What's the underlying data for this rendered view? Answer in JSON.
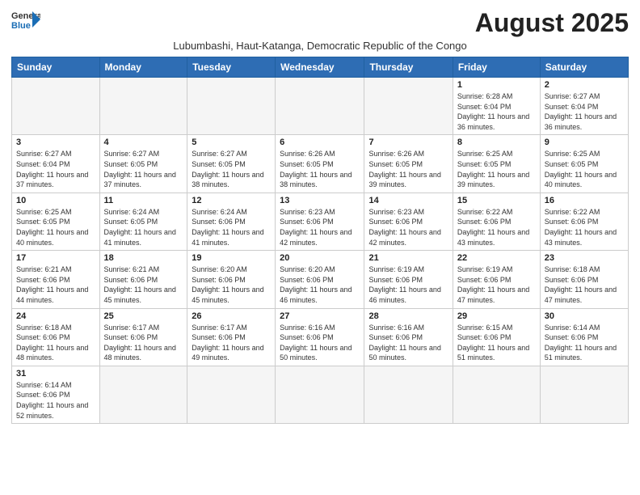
{
  "logo": {
    "line1": "General",
    "line2": "Blue"
  },
  "title": "August 2025",
  "subtitle": "Lubumbashi, Haut-Katanga, Democratic Republic of the Congo",
  "days_of_week": [
    "Sunday",
    "Monday",
    "Tuesday",
    "Wednesday",
    "Thursday",
    "Friday",
    "Saturday"
  ],
  "weeks": [
    [
      {
        "day": "",
        "info": ""
      },
      {
        "day": "",
        "info": ""
      },
      {
        "day": "",
        "info": ""
      },
      {
        "day": "",
        "info": ""
      },
      {
        "day": "",
        "info": ""
      },
      {
        "day": "1",
        "info": "Sunrise: 6:28 AM\nSunset: 6:04 PM\nDaylight: 11 hours and 36 minutes."
      },
      {
        "day": "2",
        "info": "Sunrise: 6:27 AM\nSunset: 6:04 PM\nDaylight: 11 hours and 36 minutes."
      }
    ],
    [
      {
        "day": "3",
        "info": "Sunrise: 6:27 AM\nSunset: 6:04 PM\nDaylight: 11 hours and 37 minutes."
      },
      {
        "day": "4",
        "info": "Sunrise: 6:27 AM\nSunset: 6:05 PM\nDaylight: 11 hours and 37 minutes."
      },
      {
        "day": "5",
        "info": "Sunrise: 6:27 AM\nSunset: 6:05 PM\nDaylight: 11 hours and 38 minutes."
      },
      {
        "day": "6",
        "info": "Sunrise: 6:26 AM\nSunset: 6:05 PM\nDaylight: 11 hours and 38 minutes."
      },
      {
        "day": "7",
        "info": "Sunrise: 6:26 AM\nSunset: 6:05 PM\nDaylight: 11 hours and 39 minutes."
      },
      {
        "day": "8",
        "info": "Sunrise: 6:25 AM\nSunset: 6:05 PM\nDaylight: 11 hours and 39 minutes."
      },
      {
        "day": "9",
        "info": "Sunrise: 6:25 AM\nSunset: 6:05 PM\nDaylight: 11 hours and 40 minutes."
      }
    ],
    [
      {
        "day": "10",
        "info": "Sunrise: 6:25 AM\nSunset: 6:05 PM\nDaylight: 11 hours and 40 minutes."
      },
      {
        "day": "11",
        "info": "Sunrise: 6:24 AM\nSunset: 6:05 PM\nDaylight: 11 hours and 41 minutes."
      },
      {
        "day": "12",
        "info": "Sunrise: 6:24 AM\nSunset: 6:06 PM\nDaylight: 11 hours and 41 minutes."
      },
      {
        "day": "13",
        "info": "Sunrise: 6:23 AM\nSunset: 6:06 PM\nDaylight: 11 hours and 42 minutes."
      },
      {
        "day": "14",
        "info": "Sunrise: 6:23 AM\nSunset: 6:06 PM\nDaylight: 11 hours and 42 minutes."
      },
      {
        "day": "15",
        "info": "Sunrise: 6:22 AM\nSunset: 6:06 PM\nDaylight: 11 hours and 43 minutes."
      },
      {
        "day": "16",
        "info": "Sunrise: 6:22 AM\nSunset: 6:06 PM\nDaylight: 11 hours and 43 minutes."
      }
    ],
    [
      {
        "day": "17",
        "info": "Sunrise: 6:21 AM\nSunset: 6:06 PM\nDaylight: 11 hours and 44 minutes."
      },
      {
        "day": "18",
        "info": "Sunrise: 6:21 AM\nSunset: 6:06 PM\nDaylight: 11 hours and 45 minutes."
      },
      {
        "day": "19",
        "info": "Sunrise: 6:20 AM\nSunset: 6:06 PM\nDaylight: 11 hours and 45 minutes."
      },
      {
        "day": "20",
        "info": "Sunrise: 6:20 AM\nSunset: 6:06 PM\nDaylight: 11 hours and 46 minutes."
      },
      {
        "day": "21",
        "info": "Sunrise: 6:19 AM\nSunset: 6:06 PM\nDaylight: 11 hours and 46 minutes."
      },
      {
        "day": "22",
        "info": "Sunrise: 6:19 AM\nSunset: 6:06 PM\nDaylight: 11 hours and 47 minutes."
      },
      {
        "day": "23",
        "info": "Sunrise: 6:18 AM\nSunset: 6:06 PM\nDaylight: 11 hours and 47 minutes."
      }
    ],
    [
      {
        "day": "24",
        "info": "Sunrise: 6:18 AM\nSunset: 6:06 PM\nDaylight: 11 hours and 48 minutes."
      },
      {
        "day": "25",
        "info": "Sunrise: 6:17 AM\nSunset: 6:06 PM\nDaylight: 11 hours and 48 minutes."
      },
      {
        "day": "26",
        "info": "Sunrise: 6:17 AM\nSunset: 6:06 PM\nDaylight: 11 hours and 49 minutes."
      },
      {
        "day": "27",
        "info": "Sunrise: 6:16 AM\nSunset: 6:06 PM\nDaylight: 11 hours and 50 minutes."
      },
      {
        "day": "28",
        "info": "Sunrise: 6:16 AM\nSunset: 6:06 PM\nDaylight: 11 hours and 50 minutes."
      },
      {
        "day": "29",
        "info": "Sunrise: 6:15 AM\nSunset: 6:06 PM\nDaylight: 11 hours and 51 minutes."
      },
      {
        "day": "30",
        "info": "Sunrise: 6:14 AM\nSunset: 6:06 PM\nDaylight: 11 hours and 51 minutes."
      }
    ],
    [
      {
        "day": "31",
        "info": "Sunrise: 6:14 AM\nSunset: 6:06 PM\nDaylight: 11 hours and 52 minutes."
      },
      {
        "day": "",
        "info": ""
      },
      {
        "day": "",
        "info": ""
      },
      {
        "day": "",
        "info": ""
      },
      {
        "day": "",
        "info": ""
      },
      {
        "day": "",
        "info": ""
      },
      {
        "day": "",
        "info": ""
      }
    ]
  ]
}
